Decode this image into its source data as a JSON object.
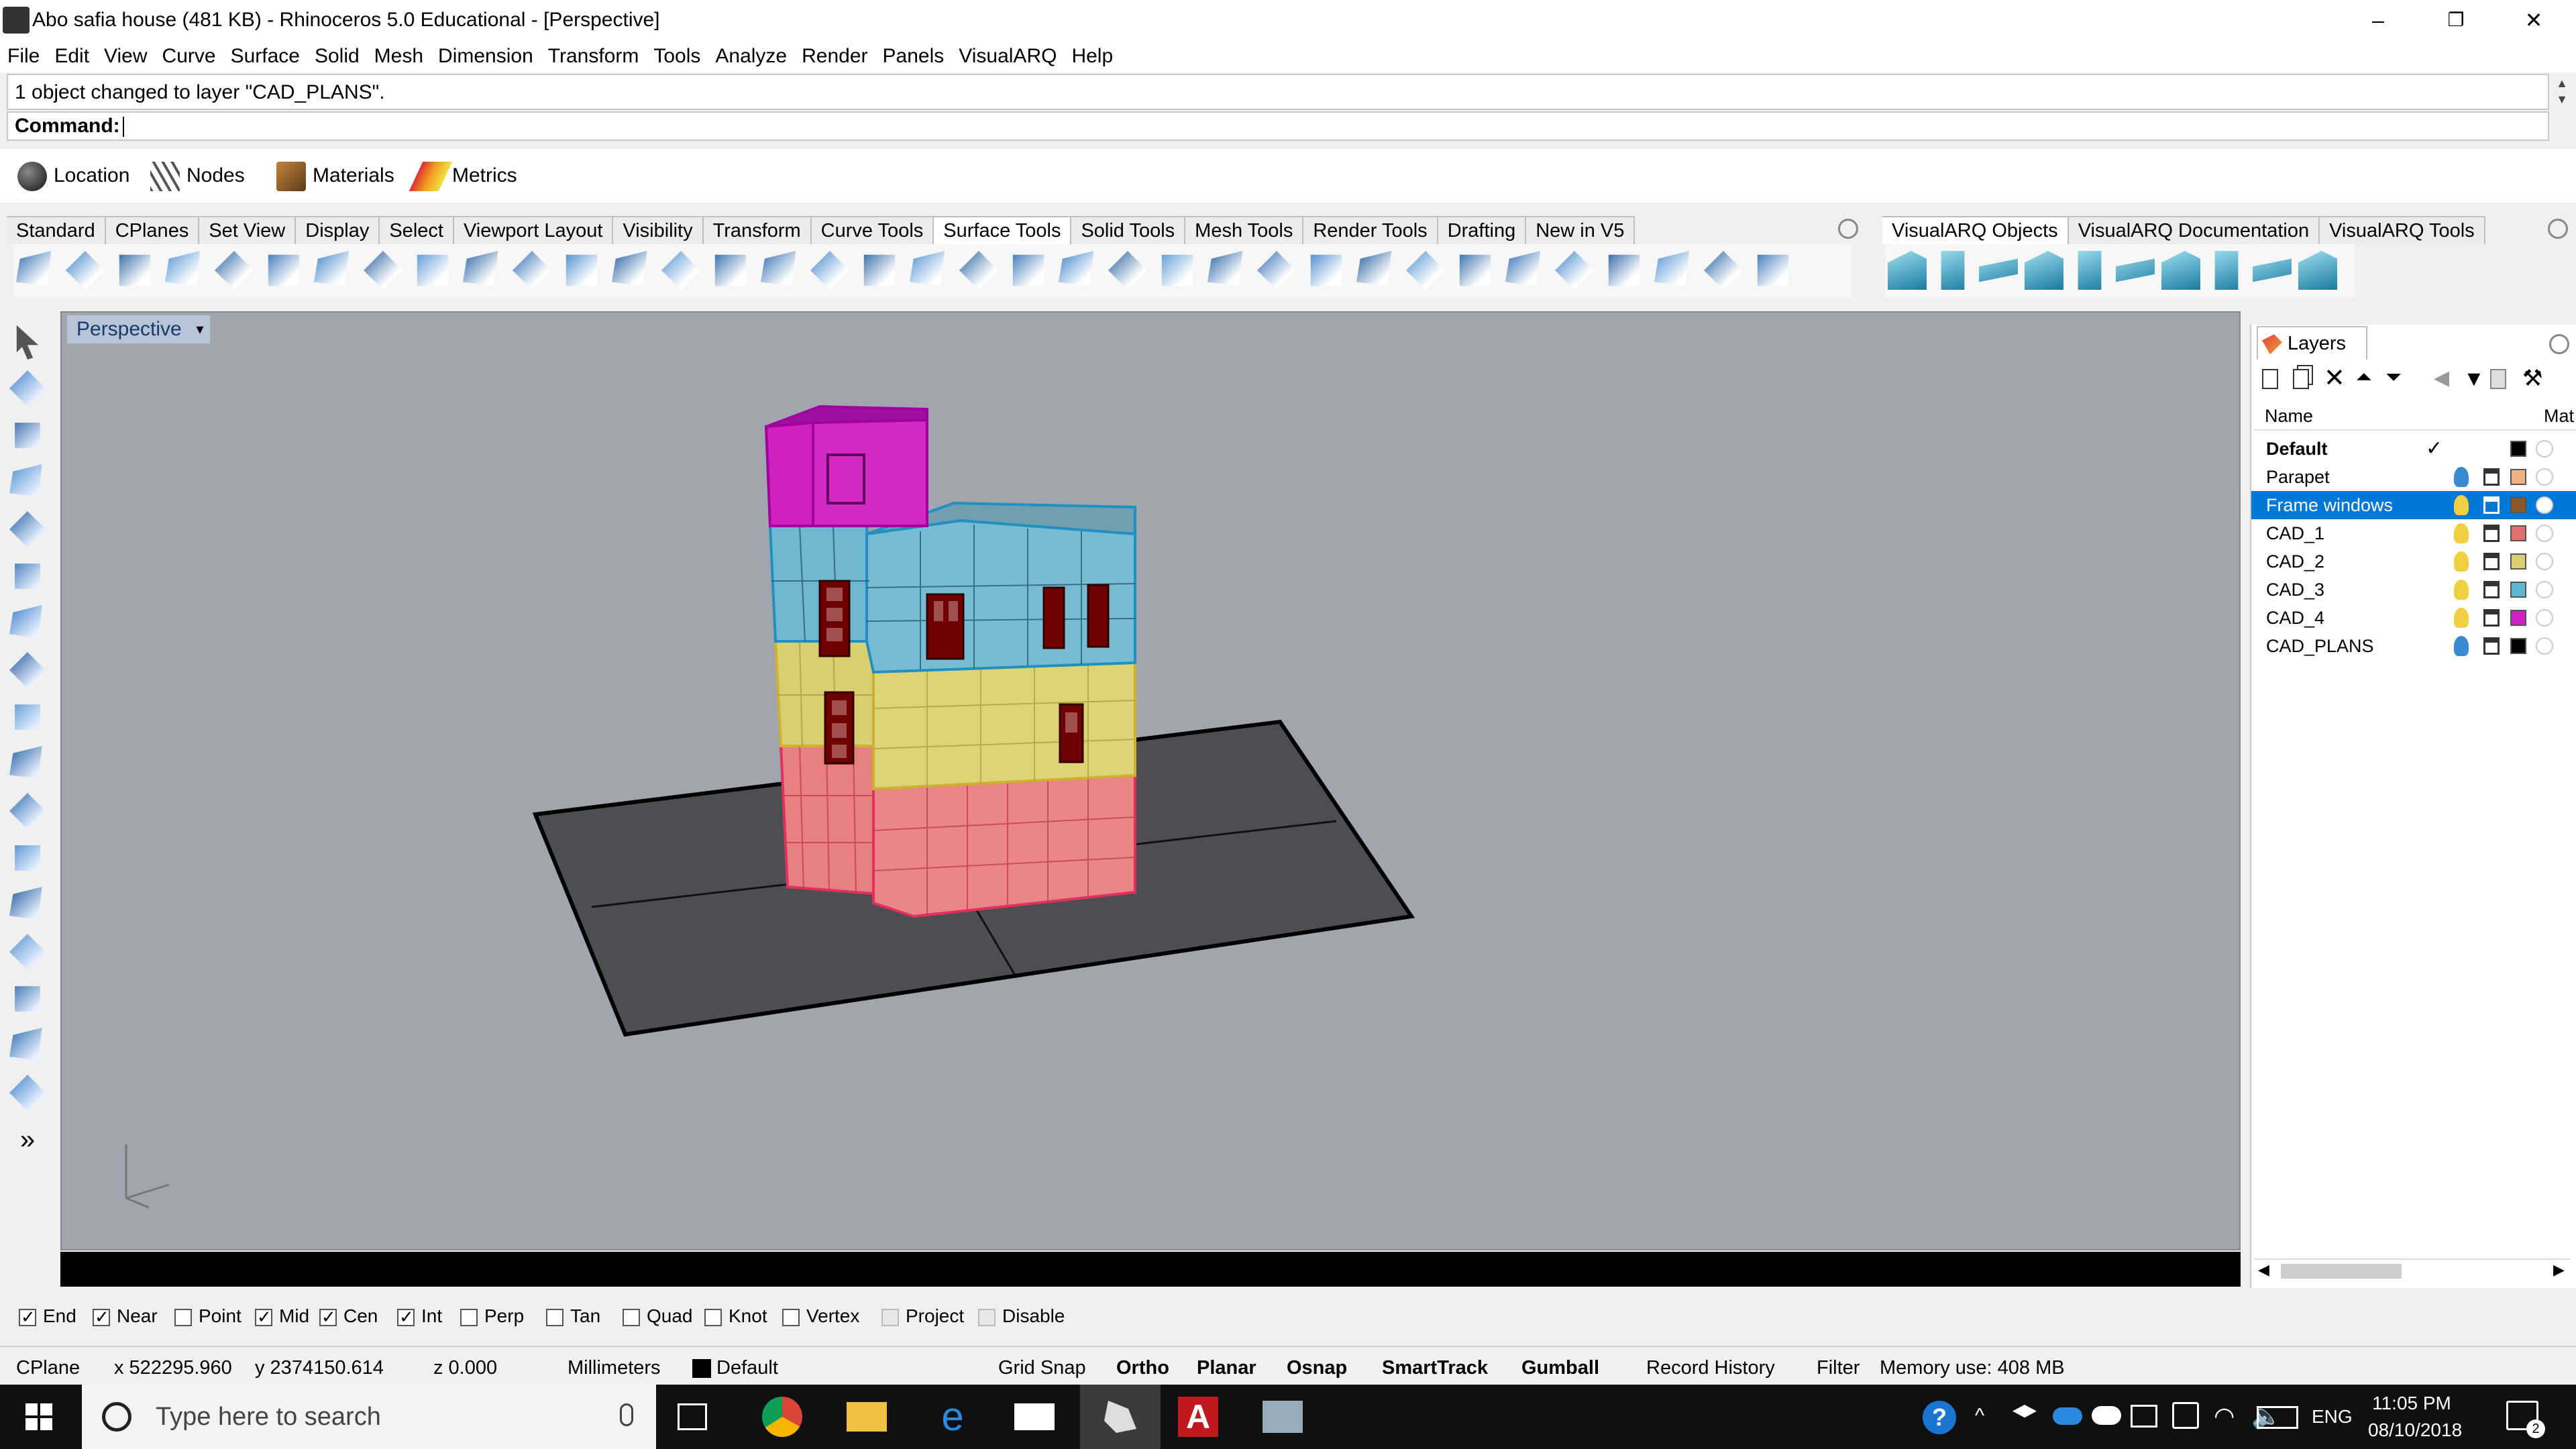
{
  "window": {
    "title": "Abo safia house (481 KB) - Rhinoceros 5.0 Educational - [Perspective]",
    "minimize": "–",
    "restore": "❐",
    "close": "✕"
  },
  "menu": [
    "File",
    "Edit",
    "View",
    "Curve",
    "Surface",
    "Solid",
    "Mesh",
    "Dimension",
    "Transform",
    "Tools",
    "Analyze",
    "Render",
    "Panels",
    "VisualARQ",
    "Help"
  ],
  "command": {
    "history": "1 object changed to layer \"CAD_PLANS\".",
    "prompt": "Command:"
  },
  "plugin_toolbar": [
    {
      "label": "Location",
      "icon": "globe-icon"
    },
    {
      "label": "Nodes",
      "icon": "nodes-icon"
    },
    {
      "label": "Materials",
      "icon": "materials-icon"
    },
    {
      "label": "Metrics",
      "icon": "metrics-icon"
    }
  ],
  "toolbar_tabs": [
    "Standard",
    "CPlanes",
    "Set View",
    "Display",
    "Select",
    "Viewport Layout",
    "Visibility",
    "Transform",
    "Curve Tools",
    "Surface Tools",
    "Solid Tools",
    "Mesh Tools",
    "Render Tools",
    "Drafting",
    "New in V5"
  ],
  "toolbar_tabs_active": "Surface Tools",
  "visualarq_tabs": [
    "VisualARQ Objects",
    "VisualARQ Documentation",
    "VisualARQ Tools"
  ],
  "visualarq_tabs_active": "VisualARQ Objects",
  "surface_tool_icons": [
    "fillet-edge-icon",
    "blend-surface-icon",
    "offset-surface-icon",
    "extend-surface-icon",
    "split-surface-icon",
    "trim-icon",
    "untrim-icon",
    "shrink-icon",
    "rebuild-icon",
    "match-icon",
    "merge-icon",
    "join-icon",
    "unroll-icon",
    "flow-icon",
    "network-icon",
    "sweep-icon",
    "heightfield-icon",
    "fit-icon",
    "deg-icon",
    "edit-pts-icon",
    "analyze-icon",
    "frame-icon",
    "control-pts-icon",
    "move-uvn-icon",
    "cap-icon",
    "pipe-icon",
    "patch-icon",
    "contour-icon",
    "explode-icon",
    "drape-icon",
    "columns-icon",
    "bevel-icon",
    "dimension-icon",
    "zebra-icon",
    "draft-icon",
    "curvature-icon"
  ],
  "visualarq_icons": [
    "wall-icon",
    "curtain-wall-icon",
    "slab-icon",
    "column-icon",
    "window-icon",
    "door-icon",
    "beam-icon",
    "railing-icon",
    "roof-icon",
    "stair-icon"
  ],
  "left_tool_icons": [
    "select-arrow-icon",
    "point-icon",
    "polyline-icon",
    "curve-icon",
    "surface-icon",
    "extrude-icon",
    "box-icon",
    "sphere-icon",
    "cylinder-icon",
    "revolve-icon",
    "mesh-icon",
    "array-icon",
    "mirror-icon",
    "transform-icon",
    "dimension-icon",
    "render-icon",
    "layer-icon",
    "more-chevron-icon"
  ],
  "viewport": {
    "title": "Perspective",
    "dropdown": "▾"
  },
  "layers_panel": {
    "tab": "Layers",
    "columns": {
      "name": "Name",
      "material": "Mat"
    },
    "rows": [
      {
        "name": "Default",
        "current": true,
        "color": "#000000",
        "bulb": "hidden",
        "selected": false
      },
      {
        "name": "Parapet",
        "current": false,
        "color": "#f0b080",
        "bulb": "blue",
        "selected": false
      },
      {
        "name": "Frame windows",
        "current": false,
        "color": "#8b5a2b",
        "bulb": "yellow",
        "selected": true
      },
      {
        "name": "CAD_1",
        "current": false,
        "color": "#e07070",
        "bulb": "yellow",
        "selected": false
      },
      {
        "name": "CAD_2",
        "current": false,
        "color": "#d8d070",
        "bulb": "yellow",
        "selected": false
      },
      {
        "name": "CAD_3",
        "current": false,
        "color": "#60b8d0",
        "bulb": "yellow",
        "selected": false
      },
      {
        "name": "CAD_4",
        "current": false,
        "color": "#d020c0",
        "bulb": "yellow",
        "selected": false
      },
      {
        "name": "CAD_PLANS",
        "current": false,
        "color": "#000000",
        "bulb": "blue",
        "selected": false
      }
    ],
    "check_mark": "✓"
  },
  "osnaps": [
    {
      "label": "End",
      "checked": true
    },
    {
      "label": "Near",
      "checked": true
    },
    {
      "label": "Point",
      "checked": false
    },
    {
      "label": "Mid",
      "checked": true
    },
    {
      "label": "Cen",
      "checked": true
    },
    {
      "label": "Int",
      "checked": true
    },
    {
      "label": "Perp",
      "checked": false
    },
    {
      "label": "Tan",
      "checked": false
    },
    {
      "label": "Quad",
      "checked": false
    },
    {
      "label": "Knot",
      "checked": false
    },
    {
      "label": "Vertex",
      "checked": false
    },
    {
      "label": "Project",
      "checked": false,
      "disabled": true
    },
    {
      "label": "Disable",
      "checked": false,
      "disabled": true
    }
  ],
  "status": {
    "cplane": "CPlane",
    "x": "x 522295.960",
    "y": "y 2374150.614",
    "z": "z 0.000",
    "units": "Millimeters",
    "layer": "Default",
    "layer_color": "#000000",
    "grid_snap": "Grid Snap",
    "ortho": "Ortho",
    "planar": "Planar",
    "osnap": "Osnap",
    "smarttrack": "SmartTrack",
    "gumball": "Gumball",
    "record_history": "Record History",
    "filter": "Filter",
    "memory": "Memory use: 408 MB"
  },
  "taskbar": {
    "search_placeholder": "Type here to search",
    "language": "ENG",
    "time": "11:05 PM",
    "date": "08/10/2018",
    "notification_count": "2",
    "apps": [
      "chrome-icon",
      "file-explorer-icon",
      "edge-icon",
      "mail-icon",
      "rhino-icon",
      "autocad-icon",
      "teamviewer-icon"
    ]
  }
}
